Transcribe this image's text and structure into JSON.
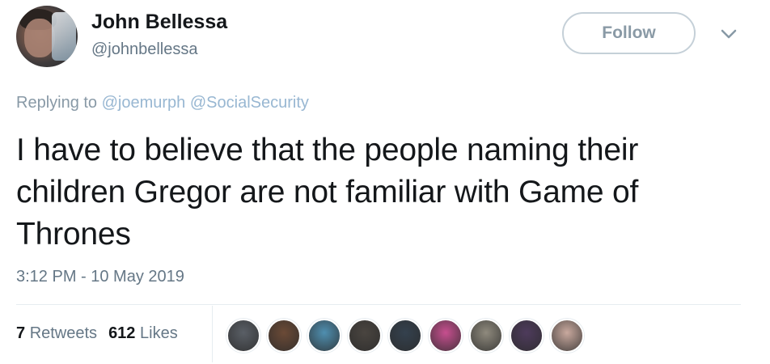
{
  "user": {
    "name": "John Bellessa",
    "handle": "@johnbellessa",
    "follow_label": "Follow"
  },
  "replying": {
    "prefix": "Replying to",
    "mentions": [
      "@joemurph",
      "@SocialSecurity"
    ]
  },
  "tweet": {
    "text": "I have to believe that the people naming their children Gregor are not familiar with Game of Thrones",
    "timestamp": "3:12 PM - 10 May 2019"
  },
  "stats": {
    "retweets_count": "7",
    "retweets_label": "Retweets",
    "likes_count": "612",
    "likes_label": "Likes"
  },
  "likers": [
    {
      "color": "#5a5f66"
    },
    {
      "color": "#6b4a36"
    },
    {
      "color": "#4f8fb0"
    },
    {
      "color": "#4a4540"
    },
    {
      "color": "#34414e"
    },
    {
      "color": "#c74f8f"
    },
    {
      "color": "#8f8a7d"
    },
    {
      "color": "#4e3b5c"
    },
    {
      "color": "#c9a99e"
    }
  ],
  "icons": {
    "caret": "chevron-down-icon"
  }
}
